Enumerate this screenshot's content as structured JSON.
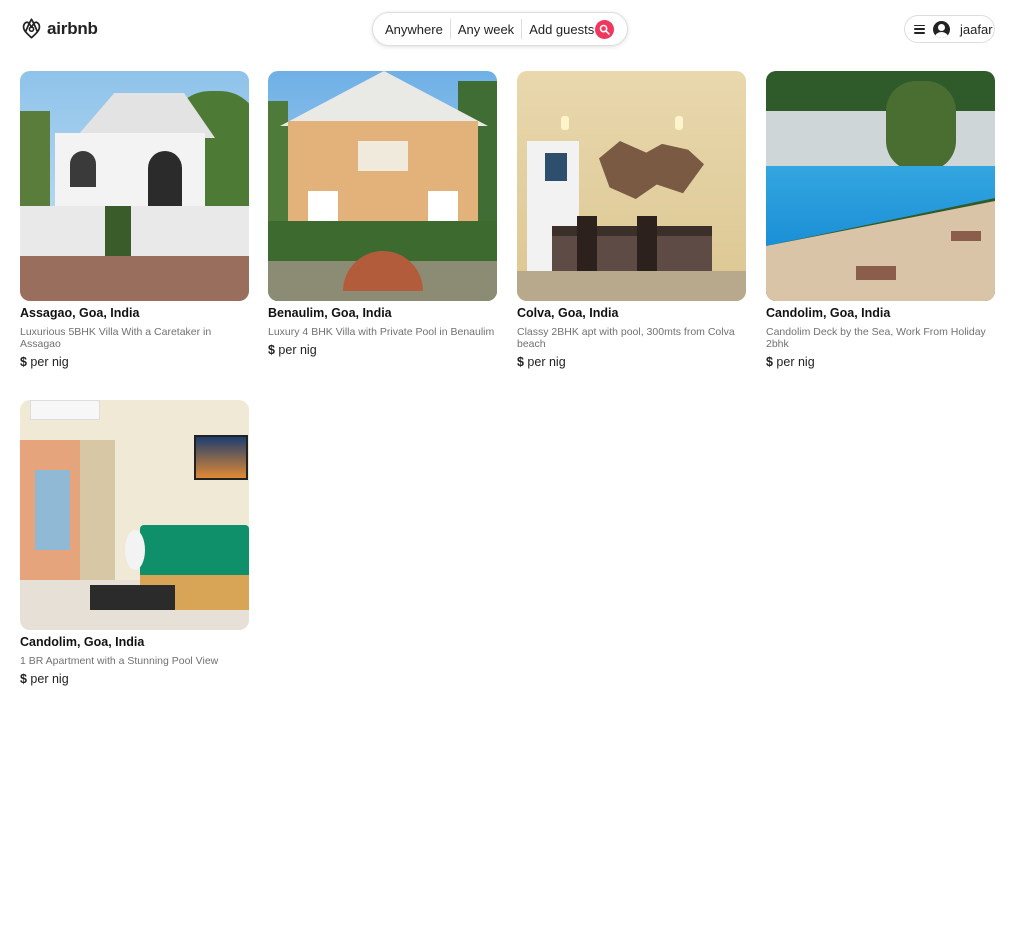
{
  "header": {
    "logo_text": "airbnb",
    "search": {
      "where": "Anywhere",
      "when": "Any week",
      "who": "Add guests"
    },
    "user_name": "jaafar",
    "accent_color": "#f0385e"
  },
  "listings": [
    {
      "location": "Assagao, Goa, India",
      "description": "Luxurious 5BHK Villa With a Caretaker in Assagao",
      "price_symbol": "$",
      "price_suffix": " per nig"
    },
    {
      "location": "Benaulim, Goa, India",
      "description": "Luxury 4 BHK Villa with Private Pool in Benaulim",
      "price_symbol": "$",
      "price_suffix": " per nig"
    },
    {
      "location": "Colva, Goa, India",
      "description": "Classy 2BHK apt with pool, 300mts from Colva beach",
      "price_symbol": "$",
      "price_suffix": " per nig"
    },
    {
      "location": "Candolim, Goa, India",
      "description": "Candolim Deck by the Sea, Work From Holiday 2bhk",
      "price_symbol": "$",
      "price_suffix": " per nig"
    },
    {
      "location": "Candolim, Goa, India",
      "description": "1 BR Apartment with a Stunning Pool View",
      "price_symbol": "$",
      "price_suffix": " per nig"
    }
  ]
}
